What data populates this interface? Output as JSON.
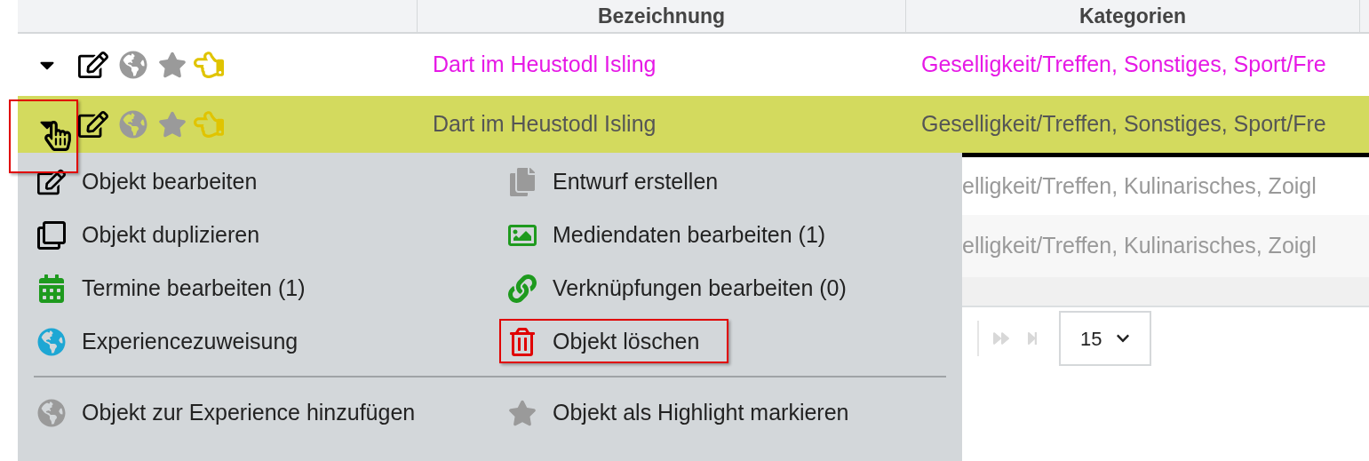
{
  "table": {
    "columns": [
      "Bezeichnung",
      "Kategorien"
    ],
    "rows": [
      {
        "expanded": false,
        "selected": false,
        "highlighted": false,
        "name": "Dart im Heustodl Isling",
        "categories": "Geselligkeit/Treffen, Sonstiges, Sport/Fre",
        "color": "#e619e6"
      },
      {
        "expanded": true,
        "selected": true,
        "highlighted": true,
        "name": "Dart im Heustodl Isling",
        "categories": "Geselligkeit/Treffen, Sonstiges, Sport/Fre",
        "color": "#555555"
      },
      {
        "kind": "partial",
        "categories": "elligkeit/Treffen, Kulinarisches, Zoigl",
        "color": "#999999"
      },
      {
        "kind": "partial",
        "categories": "elligkeit/Treffen, Kulinarisches, Zoigl",
        "color": "#999999"
      }
    ]
  },
  "pagination": {
    "page_size": "15"
  },
  "context_menu": {
    "sections": [
      {
        "items": [
          {
            "kind": "edit",
            "label": "Objekt bearbeiten",
            "highlighted": false
          },
          {
            "kind": "draft",
            "label": "Entwurf erstellen",
            "highlighted": false
          },
          {
            "kind": "duplicate",
            "label": "Objekt duplizieren",
            "highlighted": false
          },
          {
            "kind": "image",
            "label": "Mediendaten bearbeiten (1)",
            "highlighted": false
          },
          {
            "kind": "calendar",
            "label": "Termine bearbeiten (1)",
            "highlighted": false
          },
          {
            "kind": "link",
            "label": "Verknüpfungen bearbeiten (0)",
            "highlighted": false
          },
          {
            "kind": "assign",
            "label": "Experiencezuweisung",
            "highlighted": false
          },
          {
            "kind": "delete",
            "label": "Objekt löschen",
            "highlighted": true
          }
        ]
      },
      {
        "items": [
          {
            "kind": "experience",
            "label": "Objekt zur Experience hinzufügen",
            "highlighted": false
          },
          {
            "kind": "highlight",
            "label": "Objekt als Highlight markieren",
            "highlighted": false
          }
        ]
      }
    ]
  }
}
